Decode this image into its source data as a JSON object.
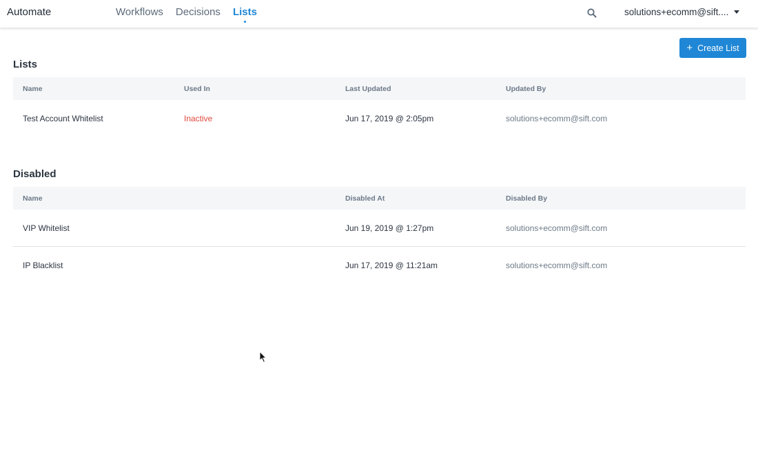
{
  "header": {
    "app_title": "Automate",
    "tabs": [
      {
        "label": "Workflows",
        "active": false
      },
      {
        "label": "Decisions",
        "active": false
      },
      {
        "label": "Lists",
        "active": true
      }
    ],
    "search_icon": "search-icon",
    "user_email": "solutions+ecomm@sift....",
    "user_menu_icon": "chevron-down-icon"
  },
  "actions": {
    "create_list_label": "Create List",
    "create_list_icon": "plus-icon"
  },
  "lists_section": {
    "title": "Lists",
    "columns": [
      "Name",
      "Used In",
      "Last Updated",
      "Updated By"
    ],
    "rows": [
      {
        "name": "Test Account Whitelist",
        "used_in": "Inactive",
        "last_updated": "Jun 17, 2019 @ 2:05pm",
        "updated_by": "solutions+ecomm@sift.com"
      }
    ]
  },
  "disabled_section": {
    "title": "Disabled",
    "columns": [
      "Name",
      "Disabled At",
      "Disabled By"
    ],
    "rows": [
      {
        "name": "VIP Whitelist",
        "disabled_at": "Jun 19, 2019 @ 1:27pm",
        "disabled_by": "solutions+ecomm@sift.com"
      },
      {
        "name": "IP Blacklist",
        "disabled_at": "Jun 17, 2019 @ 11:21am",
        "disabled_by": "solutions+ecomm@sift.com"
      }
    ]
  },
  "colors": {
    "accent": "#1f87d6",
    "inactive": "#e0473c",
    "header_bg": "#f4f6f8"
  }
}
